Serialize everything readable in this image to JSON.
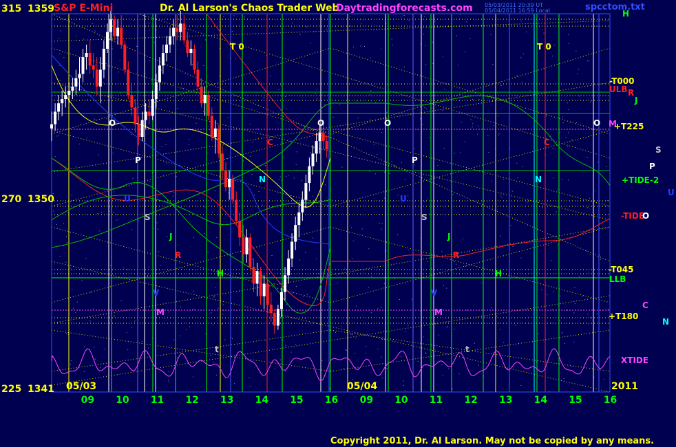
{
  "header": {
    "symbol": "S&P E-Mini",
    "title": "Dr. Al Larson's Chaos Trader Web",
    "site": "Daytradingforecasts.com",
    "stamp_line1": "05/03/2011 20:39 UT",
    "stamp_line2": "05/04/2011 16:59 Local",
    "file": "spcctom.txt"
  },
  "footer": {
    "copyright": "Copyright 2011, Dr. Al Larson. May not be copied by any means."
  },
  "colors": {
    "background": "#000050",
    "grid_yellow": "#ffff00",
    "grid_green": "#00ff00",
    "vline_white": "#ffffff",
    "vline_blue": "#4060ff",
    "xtide": "#ff44ff"
  },
  "chart_data": {
    "type": "candlestick",
    "title": "S&P E-Mini",
    "y_axis": {
      "range": [
        1341,
        1359
      ],
      "ticks": [
        {
          "code": "315",
          "price": "1359",
          "value": 1359
        },
        {
          "code": "270",
          "price": "1350",
          "value": 1350
        },
        {
          "code": "225",
          "price": "1341",
          "value": 1341
        }
      ]
    },
    "x_axis": {
      "range": [
        8.0,
        16.1
      ],
      "date_labels": [
        "05/03",
        "05/04"
      ],
      "year_label": "2011",
      "hour_ticks": [
        "09",
        "10",
        "11",
        "12",
        "13",
        "14",
        "15",
        "16",
        "09",
        "10",
        "11",
        "12",
        "13",
        "14",
        "15",
        "16"
      ]
    },
    "candles_0503": [
      [
        8.0,
        1353.4,
        1354.2,
        1352.8,
        1353.6
      ],
      [
        8.1,
        1353.6,
        1354.6,
        1353.3,
        1354.2
      ],
      [
        8.2,
        1354.2,
        1355.0,
        1353.8,
        1354.6
      ],
      [
        8.3,
        1354.6,
        1355.2,
        1354.0,
        1354.8
      ],
      [
        8.4,
        1354.8,
        1355.4,
        1354.4,
        1355.0
      ],
      [
        8.5,
        1355.0,
        1355.6,
        1354.6,
        1355.2
      ],
      [
        8.6,
        1355.2,
        1355.8,
        1354.8,
        1355.4
      ],
      [
        8.7,
        1355.4,
        1356.2,
        1355.0,
        1355.8
      ],
      [
        8.8,
        1355.8,
        1356.8,
        1355.2,
        1356.0
      ],
      [
        8.9,
        1356.0,
        1357.2,
        1355.6,
        1356.8
      ],
      [
        9.0,
        1356.8,
        1357.4,
        1356.2,
        1357.0
      ],
      [
        9.1,
        1357.0,
        1357.6,
        1356.0,
        1356.4
      ],
      [
        9.2,
        1356.4,
        1357.0,
        1355.8,
        1356.2
      ],
      [
        9.3,
        1356.2,
        1356.8,
        1355.0,
        1355.4
      ],
      [
        9.4,
        1355.4,
        1356.8,
        1354.6,
        1356.2
      ],
      [
        9.5,
        1356.2,
        1357.6,
        1355.8,
        1357.2
      ],
      [
        9.6,
        1357.2,
        1358.4,
        1357.0,
        1358.0
      ],
      [
        9.7,
        1358.0,
        1359.0,
        1357.6,
        1358.6
      ],
      [
        9.8,
        1358.6,
        1358.8,
        1357.6,
        1357.8
      ],
      [
        9.9,
        1357.8,
        1358.6,
        1357.4,
        1358.2
      ],
      [
        10.0,
        1358.2,
        1358.8,
        1357.2,
        1357.4
      ],
      [
        10.1,
        1357.4,
        1357.6,
        1356.0,
        1356.2
      ],
      [
        10.2,
        1356.2,
        1356.6,
        1354.8,
        1355.0
      ],
      [
        10.3,
        1355.0,
        1355.6,
        1354.0,
        1354.4
      ],
      [
        10.4,
        1354.4,
        1354.8,
        1353.2,
        1353.6
      ],
      [
        10.5,
        1353.6,
        1354.0,
        1352.6,
        1353.0
      ],
      [
        10.6,
        1353.0,
        1354.2,
        1352.8,
        1353.8
      ],
      [
        10.7,
        1353.8,
        1354.6,
        1353.4,
        1354.2
      ],
      [
        10.8,
        1354.2,
        1354.8,
        1353.6,
        1354.0
      ],
      [
        10.9,
        1354.0,
        1355.2,
        1353.8,
        1354.8
      ],
      [
        11.0,
        1354.8,
        1356.0,
        1354.4,
        1355.6
      ],
      [
        11.1,
        1355.6,
        1356.8,
        1355.2,
        1356.4
      ],
      [
        11.2,
        1356.4,
        1357.4,
        1356.0,
        1357.0
      ],
      [
        11.3,
        1357.0,
        1357.8,
        1356.6,
        1357.4
      ],
      [
        11.4,
        1357.4,
        1358.2,
        1357.0,
        1357.8
      ],
      [
        11.5,
        1357.8,
        1358.6,
        1357.4,
        1358.2
      ],
      [
        11.6,
        1358.2,
        1358.8,
        1357.6,
        1358.0
      ],
      [
        11.7,
        1358.0,
        1359.0,
        1357.6,
        1358.4
      ],
      [
        11.8,
        1358.4,
        1358.8,
        1357.4,
        1357.6
      ],
      [
        11.9,
        1357.6,
        1358.0,
        1356.8,
        1357.0
      ],
      [
        12.0,
        1357.0,
        1357.6,
        1356.4,
        1357.2
      ],
      [
        12.1,
        1357.2,
        1357.4,
        1356.0,
        1356.2
      ],
      [
        12.2,
        1356.2,
        1356.6,
        1355.2,
        1355.4
      ],
      [
        12.3,
        1355.4,
        1355.8,
        1354.4,
        1354.6
      ],
      [
        12.4,
        1354.6,
        1355.4,
        1354.0,
        1355.0
      ],
      [
        12.5,
        1355.0,
        1355.2,
        1353.8,
        1354.0
      ],
      [
        12.6,
        1354.0,
        1354.4,
        1352.8,
        1353.0
      ],
      [
        12.7,
        1353.0,
        1353.8,
        1352.2,
        1353.4
      ],
      [
        12.8,
        1353.4,
        1353.6,
        1352.0,
        1352.2
      ],
      [
        12.9,
        1352.2,
        1352.6,
        1351.0,
        1351.4
      ],
      [
        13.0,
        1351.4,
        1351.8,
        1350.4,
        1350.6
      ],
      [
        13.1,
        1350.6,
        1351.4,
        1350.0,
        1351.0
      ],
      [
        13.2,
        1351.0,
        1351.2,
        1349.8,
        1350.0
      ],
      [
        13.3,
        1350.0,
        1350.4,
        1348.8,
        1349.0
      ],
      [
        13.4,
        1349.0,
        1349.4,
        1347.8,
        1348.2
      ],
      [
        13.5,
        1348.2,
        1348.8,
        1347.0,
        1347.4
      ],
      [
        13.6,
        1347.4,
        1348.6,
        1347.0,
        1348.2
      ],
      [
        13.7,
        1348.2,
        1348.4,
        1346.6,
        1346.8
      ],
      [
        13.8,
        1346.8,
        1347.2,
        1345.6,
        1346.0
      ],
      [
        13.9,
        1346.0,
        1347.0,
        1345.4,
        1346.6
      ],
      [
        14.0,
        1346.6,
        1346.8,
        1345.0,
        1345.4
      ],
      [
        14.1,
        1345.4,
        1346.4,
        1344.8,
        1346.0
      ],
      [
        14.2,
        1346.0,
        1346.2,
        1344.6,
        1345.0
      ],
      [
        14.3,
        1345.0,
        1345.6,
        1344.2,
        1344.6
      ],
      [
        14.4,
        1344.6,
        1344.8,
        1343.6,
        1344.0
      ],
      [
        14.5,
        1344.0,
        1345.0,
        1343.8,
        1344.8
      ],
      [
        14.6,
        1344.8,
        1345.8,
        1344.4,
        1345.6
      ],
      [
        14.7,
        1345.6,
        1346.8,
        1345.2,
        1346.4
      ],
      [
        14.8,
        1346.4,
        1347.6,
        1346.0,
        1347.2
      ],
      [
        14.9,
        1347.2,
        1348.4,
        1346.8,
        1348.0
      ],
      [
        15.0,
        1348.0,
        1349.2,
        1347.6,
        1348.8
      ],
      [
        15.1,
        1348.8,
        1349.8,
        1348.2,
        1349.4
      ],
      [
        15.2,
        1349.4,
        1350.4,
        1349.0,
        1350.0
      ],
      [
        15.3,
        1350.0,
        1351.2,
        1349.6,
        1350.8
      ],
      [
        15.4,
        1350.8,
        1352.0,
        1350.4,
        1351.6
      ],
      [
        15.5,
        1351.6,
        1352.6,
        1351.2,
        1352.2
      ],
      [
        15.6,
        1352.2,
        1353.2,
        1351.8,
        1352.8
      ],
      [
        15.7,
        1352.8,
        1353.6,
        1352.2,
        1353.2
      ],
      [
        15.8,
        1353.2,
        1353.8,
        1352.4,
        1352.8
      ],
      [
        15.9,
        1352.8,
        1353.0,
        1352.0,
        1352.4
      ]
    ]
  },
  "labels": {
    "T0": "T 0",
    "O": "O",
    "P": "P",
    "S": "S",
    "J": "J",
    "R": "R",
    "H": "H",
    "N": "N",
    "C": "C",
    "M": "M",
    "U": "U",
    "V": "V",
    "t": "t"
  },
  "right_labels": {
    "H": "H",
    "T000": "-T000",
    "ULB": "ULB",
    "R": "R",
    "J": "J",
    "M": "M",
    "T225": "+T225",
    "S": "S",
    "P": "P",
    "TIDE2": "+TIDE-2",
    "U": "U",
    "TIDEm": "-TIDE",
    "O": "O",
    "T045": "-T045",
    "LLB": "LLB",
    "C": "C",
    "T180": "+T180",
    "N": "N",
    "XTIDE": "XTIDE"
  }
}
